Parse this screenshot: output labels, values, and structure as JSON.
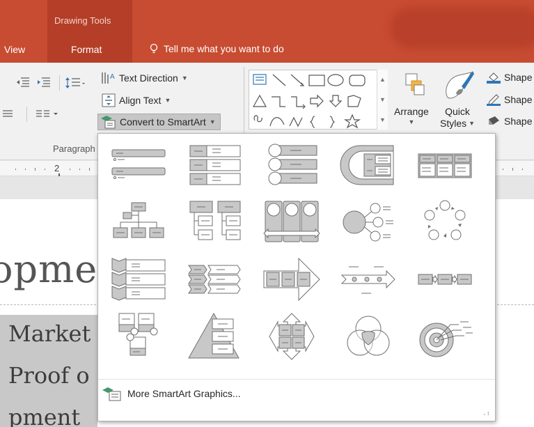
{
  "titlebar": {
    "contextual_group": "Drawing Tools",
    "tabs": [
      {
        "label": "View"
      },
      {
        "label": "Format"
      }
    ],
    "tell_me": "Tell me what you want to do"
  },
  "ribbon": {
    "text_direction": "Text Direction",
    "align_text": "Align Text",
    "convert_smartart": "Convert to SmartArt",
    "paragraph_group": "Paragraph",
    "arrange": "Arrange",
    "quick_styles_1": "Quick",
    "quick_styles_2": "Styles",
    "shape_items": [
      "Shape",
      "Shape",
      "Shape"
    ]
  },
  "ruler": {
    "mark": "2"
  },
  "slide": {
    "title_fragment": "opmen",
    "bullets": [
      "Market",
      "Proof o",
      "pment"
    ]
  },
  "smartart_menu": {
    "layouts": [
      "vertical-bullet-list",
      "stacked-list",
      "vertical-circle-list",
      "nested-target-list",
      "table-list",
      "organization-chart",
      "hierarchy-list",
      "circle-process",
      "radial-list",
      "basic-cycle",
      "vertical-chevron-list",
      "chevron-list",
      "arrow-process",
      "timeline",
      "basic-process",
      "picture-list",
      "pyramid-list",
      "matrix",
      "venn",
      "target"
    ],
    "more_label": "More SmartArt Graphics..."
  },
  "colors": {
    "title_bar": "#c84c32",
    "ribbon": "#f1f1f1",
    "gallery_fill": "#c8c8c8",
    "gallery_stroke": "#6f6f6f",
    "smartart_green": "#3f9b6b"
  }
}
